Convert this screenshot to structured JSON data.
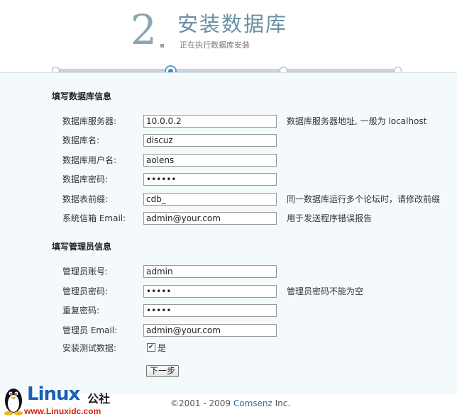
{
  "header": {
    "step_number": "2",
    "title": "安装数据库",
    "subtitle": "正在执行数据库安装"
  },
  "progress": {
    "total_steps": 4,
    "current_step": 2
  },
  "db_section": {
    "title": "填写数据库信息",
    "fields": [
      {
        "label": "数据库服务器:",
        "value": "10.0.0.2",
        "hint": "数据库服务器地址, 一般为 localhost"
      },
      {
        "label": "数据库名:",
        "value": "discuz",
        "hint": ""
      },
      {
        "label": "数据库用户名:",
        "value": "aolens",
        "hint": ""
      },
      {
        "label": "数据库密码:",
        "value": "••••••",
        "hint": ""
      },
      {
        "label": "数据表前缀:",
        "value": "cdb_",
        "hint": "同一数据库运行多个论坛时，请修改前缀"
      },
      {
        "label": "系统信箱 Email:",
        "value": "admin@your.com",
        "hint": "用于发送程序错误报告"
      }
    ]
  },
  "admin_section": {
    "title": "填写管理员信息",
    "fields": [
      {
        "label": "管理员账号:",
        "value": "admin",
        "hint": ""
      },
      {
        "label": "管理员密码:",
        "value": "•••••",
        "hint": "管理员密码不能为空"
      },
      {
        "label": "重复密码:",
        "value": "•••••",
        "hint": ""
      },
      {
        "label": "管理员 Email:",
        "value": "admin@your.com",
        "hint": ""
      }
    ],
    "test_data": {
      "label": "安装测试数据:",
      "checked": true,
      "option": "是"
    }
  },
  "next_button": "下一步",
  "footer": {
    "copyright_prefix": "©2001 - 2009 ",
    "brand": "Comsenz",
    "suffix": " Inc."
  },
  "watermark": {
    "word": "Linux",
    "suffix": "公社",
    "url": "www.Linuxidc.com"
  },
  "colors": {
    "accent": "#3b8bc0",
    "title": "#6a8fa3",
    "panel_bg": "#f4f9fc"
  }
}
